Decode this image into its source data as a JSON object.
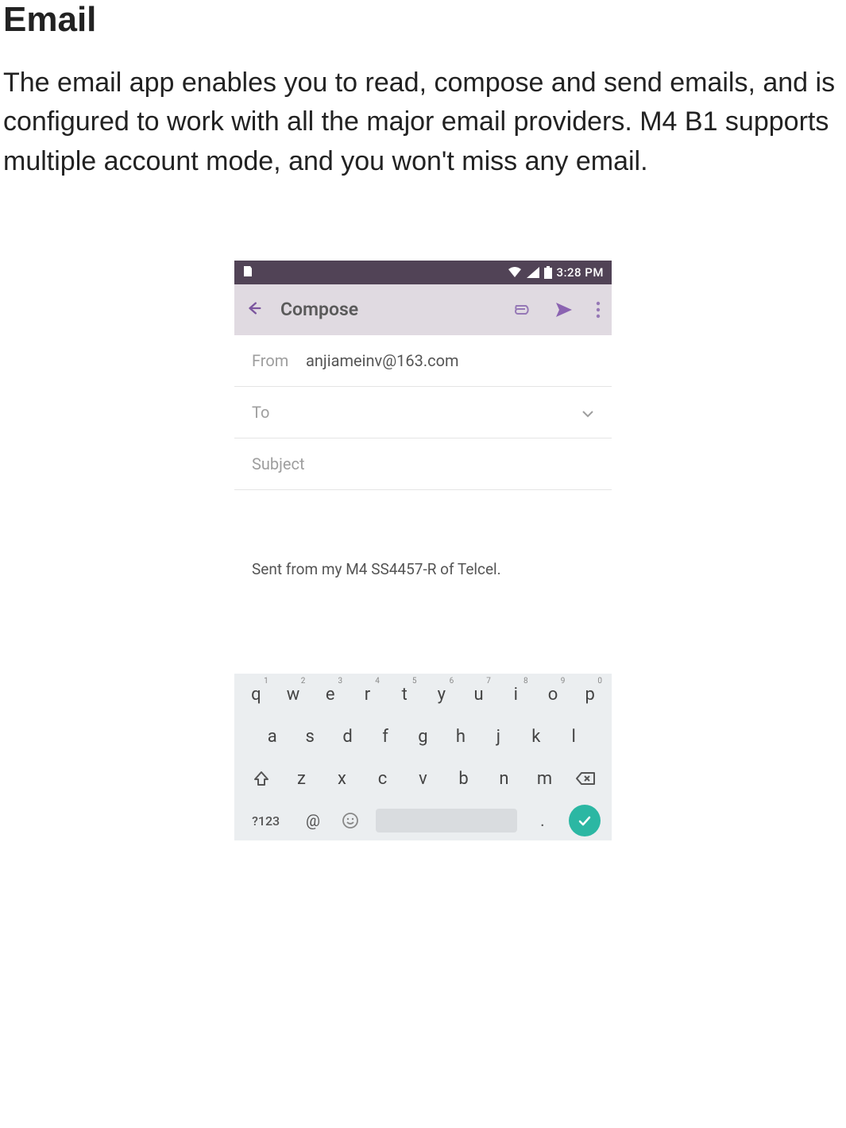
{
  "doc": {
    "title": "Email",
    "paragraph": "The email app enables you to read, compose and send emails, and is configured to work with all the major email providers. M4 B1 supports multiple account mode, and you won't miss any email."
  },
  "status_bar": {
    "time": "3:28 PM"
  },
  "app_bar": {
    "title": "Compose"
  },
  "compose": {
    "from_label": "From",
    "from_value": "anjiameinv@163.com",
    "to_label": "To",
    "subject_placeholder": "Subject",
    "signature": "Sent from my M4 SS4457-R of Telcel."
  },
  "keyboard": {
    "row1": [
      {
        "k": "q",
        "n": "1"
      },
      {
        "k": "w",
        "n": "2"
      },
      {
        "k": "e",
        "n": "3"
      },
      {
        "k": "r",
        "n": "4"
      },
      {
        "k": "t",
        "n": "5"
      },
      {
        "k": "y",
        "n": "6"
      },
      {
        "k": "u",
        "n": "7"
      },
      {
        "k": "i",
        "n": "8"
      },
      {
        "k": "o",
        "n": "9"
      },
      {
        "k": "p",
        "n": "0"
      }
    ],
    "row2": [
      "a",
      "s",
      "d",
      "f",
      "g",
      "h",
      "j",
      "k",
      "l"
    ],
    "row3": [
      "z",
      "x",
      "c",
      "v",
      "b",
      "n",
      "m"
    ],
    "sym_label": "?123",
    "at_label": "@",
    "dot_label": "."
  }
}
